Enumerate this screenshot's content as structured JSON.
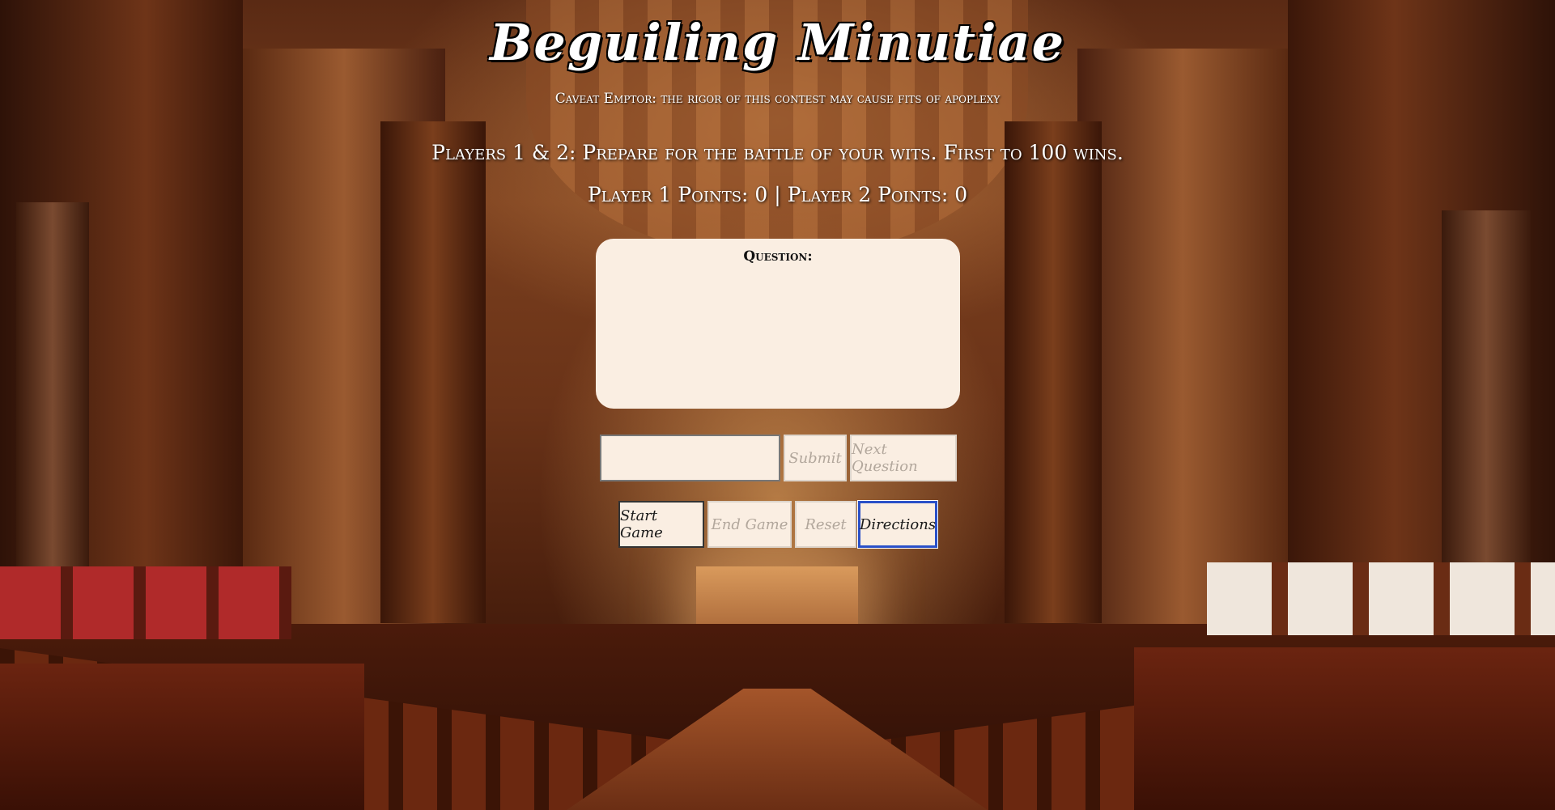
{
  "header": {
    "title": "Beguiling Minutiae",
    "tagline": "Caveat Emptor: the rigor of this contest may cause fits of apoplexy"
  },
  "intro": "Players 1 & 2: Prepare for the battle of your wits. First to 100 wins.",
  "score": {
    "player1_label": "Player 1 Points:",
    "player1_points": "0",
    "separator": "|",
    "player2_label": "Player 2 Points:",
    "player2_points": "0"
  },
  "question_panel": {
    "label": "Question:",
    "text": ""
  },
  "answer": {
    "value": "",
    "placeholder": ""
  },
  "buttons": {
    "submit": "Submit",
    "next_question": "Next Question",
    "start_game": "Start Game",
    "end_game": "End Game",
    "reset": "Reset",
    "directions": "Directions"
  },
  "colors": {
    "panel_bg": "#faeee2",
    "focus_ring": "#2a50c8",
    "disabled_text": "#b2a79c"
  }
}
